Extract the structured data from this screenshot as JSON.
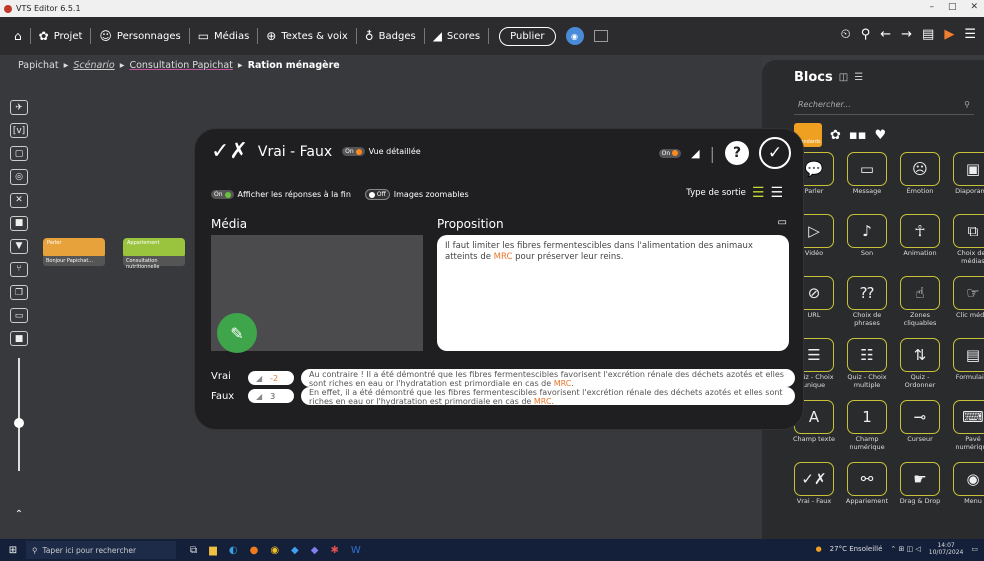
{
  "window": {
    "title": "VTS Editor 6.5.1",
    "controls": [
      "–",
      "□",
      "✕"
    ]
  },
  "toolbar": {
    "home_icon": "home-icon",
    "items": [
      {
        "label": "Projet",
        "icon": "gear-icon",
        "glyph": "✿"
      },
      {
        "label": "Personnages",
        "icon": "character-icon",
        "glyph": "☺"
      },
      {
        "label": "Médias",
        "icon": "media-icon",
        "glyph": "▭"
      },
      {
        "label": "Textes & voix",
        "icon": "text-voice-icon",
        "glyph": "⊕"
      },
      {
        "label": "Badges",
        "icon": "badge-icon",
        "glyph": "♁"
      },
      {
        "label": "Scores",
        "icon": "score-icon",
        "glyph": "◢"
      }
    ],
    "publish_label": "Publier",
    "right_icons": [
      "⏲",
      "⚲",
      "←",
      "→",
      "▤",
      "▶",
      "☰"
    ]
  },
  "breadcrumb": {
    "items": [
      {
        "label": "Papichat"
      },
      {
        "label": "Scénario"
      },
      {
        "label": "Consultation Papichat"
      },
      {
        "label": "Ration ménagère"
      }
    ],
    "sep": "▸"
  },
  "nodes": [
    {
      "label": "Parler",
      "sub": "Bonjour Papichat..."
    },
    {
      "label": "Appariement",
      "sub": "Consultation nutritionnelle"
    }
  ],
  "blocs_panel": {
    "title": "Blocs",
    "search_placeholder": "Rechercher...",
    "category_label": "Standards",
    "blocks": [
      {
        "label": "Parler",
        "icon": "speech-bubble-icon",
        "glyph": "💬"
      },
      {
        "label": "Message",
        "icon": "message-icon",
        "glyph": "▭"
      },
      {
        "label": "Émotion",
        "icon": "emotion-icon",
        "glyph": "☹"
      },
      {
        "label": "Diaporama",
        "icon": "slideshow-icon",
        "glyph": "▣"
      },
      {
        "label": "Vidéo",
        "icon": "video-icon",
        "glyph": "▷"
      },
      {
        "label": "Son",
        "icon": "sound-icon",
        "glyph": "♪"
      },
      {
        "label": "Animation",
        "icon": "animation-icon",
        "glyph": "☥"
      },
      {
        "label": "Choix des médias",
        "icon": "media-choice-icon",
        "glyph": "⧉"
      },
      {
        "label": "URL",
        "icon": "url-icon",
        "glyph": "⊘"
      },
      {
        "label": "Choix de phrases",
        "icon": "phrase-choice-icon",
        "glyph": "⁇"
      },
      {
        "label": "Zones cliquables",
        "icon": "clickable-zones-icon",
        "glyph": "☝"
      },
      {
        "label": "Clic média",
        "icon": "media-click-icon",
        "glyph": "☞"
      },
      {
        "label": "Quiz - Choix unique",
        "icon": "quiz-single-icon",
        "glyph": "☰"
      },
      {
        "label": "Quiz - Choix multiple",
        "icon": "quiz-multiple-icon",
        "glyph": "☷"
      },
      {
        "label": "Quiz - Ordonner",
        "icon": "quiz-order-icon",
        "glyph": "⇅"
      },
      {
        "label": "Formulaire",
        "icon": "form-icon",
        "glyph": "▤"
      },
      {
        "label": "Champ texte",
        "icon": "text-field-icon",
        "glyph": "A"
      },
      {
        "label": "Champ numérique",
        "icon": "number-field-icon",
        "glyph": "1"
      },
      {
        "label": "Curseur",
        "icon": "slider-icon",
        "glyph": "⊸"
      },
      {
        "label": "Pavé numérique",
        "icon": "keypad-icon",
        "glyph": "⌨"
      },
      {
        "label": "Vrai - Faux",
        "icon": "true-false-icon",
        "glyph": "✓✗"
      },
      {
        "label": "Appariement",
        "icon": "matching-icon",
        "glyph": "⚯"
      },
      {
        "label": "Drag & Drop",
        "icon": "drag-drop-icon",
        "glyph": "☛"
      },
      {
        "label": "Menu",
        "icon": "menu-icon",
        "glyph": "◉"
      }
    ]
  },
  "modal": {
    "title": "Vrai - Faux",
    "toggle_on": "On",
    "toggle_off": "Off",
    "vue_detaillee": "Vue détaillée",
    "afficher_reponses": "Afficher les réponses à la fin",
    "images_zoomables": "Images zoomables",
    "type_sortie": "Type de sortie",
    "media_label": "Média",
    "proposition_label": "Proposition",
    "proposition_text_1": "Il faut limiter les fibres fermentescibles dans l'alimentation des animaux atteints de ",
    "proposition_hl": "MRC",
    "proposition_text_2": " pour préserver leur reins.",
    "vrai_label": "Vrai",
    "faux_label": "Faux",
    "vrai_score": "-2",
    "faux_score": "3",
    "vrai_feedback_1": "Au contraire ! Il a été démontré que les fibres fermentescibles favorisent l'excrétion rénale des déchets azotés et elles sont riches en eau or l'hydratation est primordiale en cas de ",
    "vrai_feedback_hl": "MRC",
    "vrai_feedback_2": ".",
    "faux_feedback_1": "En effet, il a été démontré que les fibres fermentescibles favorisent l'excrétion rénale des déchets azotés et elles sont riches en eau or l'hydratation est primordiale en cas de ",
    "faux_feedback_hl": "MRC",
    "faux_feedback_2": "."
  },
  "taskbar": {
    "search_placeholder": "Taper ici pour rechercher",
    "weather": "27°C Ensoleillé",
    "time": "14:07",
    "date": "10/07/2024"
  }
}
